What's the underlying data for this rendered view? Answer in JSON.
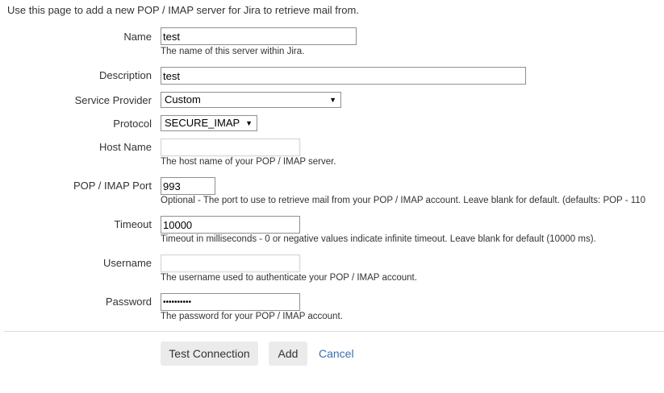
{
  "intro": "Use this page to add a new POP / IMAP server for Jira to retrieve mail from.",
  "form": {
    "name": {
      "label": "Name",
      "value": "test",
      "help": "The name of this server within Jira."
    },
    "description": {
      "label": "Description",
      "value": "test"
    },
    "service_provider": {
      "label": "Service Provider",
      "value": "Custom"
    },
    "protocol": {
      "label": "Protocol",
      "value": "SECURE_IMAP"
    },
    "host_name": {
      "label": "Host Name",
      "value": "",
      "help": "The host name of your POP / IMAP server."
    },
    "port": {
      "label": "POP / IMAP Port",
      "value": "993",
      "help": "Optional - The port to use to retrieve mail from your POP / IMAP account. Leave blank for default. (defaults: POP - 110"
    },
    "timeout": {
      "label": "Timeout",
      "value": "10000",
      "help": "Timeout in milliseconds - 0 or negative values indicate infinite timeout. Leave blank for default (10000 ms)."
    },
    "username": {
      "label": "Username",
      "value": "",
      "help": "The username used to authenticate your POP / IMAP account."
    },
    "password": {
      "label": "Password",
      "value": "••••••••••",
      "help": "The password for your POP / IMAP account."
    }
  },
  "actions": {
    "test_connection": "Test Connection",
    "add": "Add",
    "cancel": "Cancel"
  },
  "colors": {
    "link": "#3572b0",
    "button_bg": "#ebebeb"
  }
}
